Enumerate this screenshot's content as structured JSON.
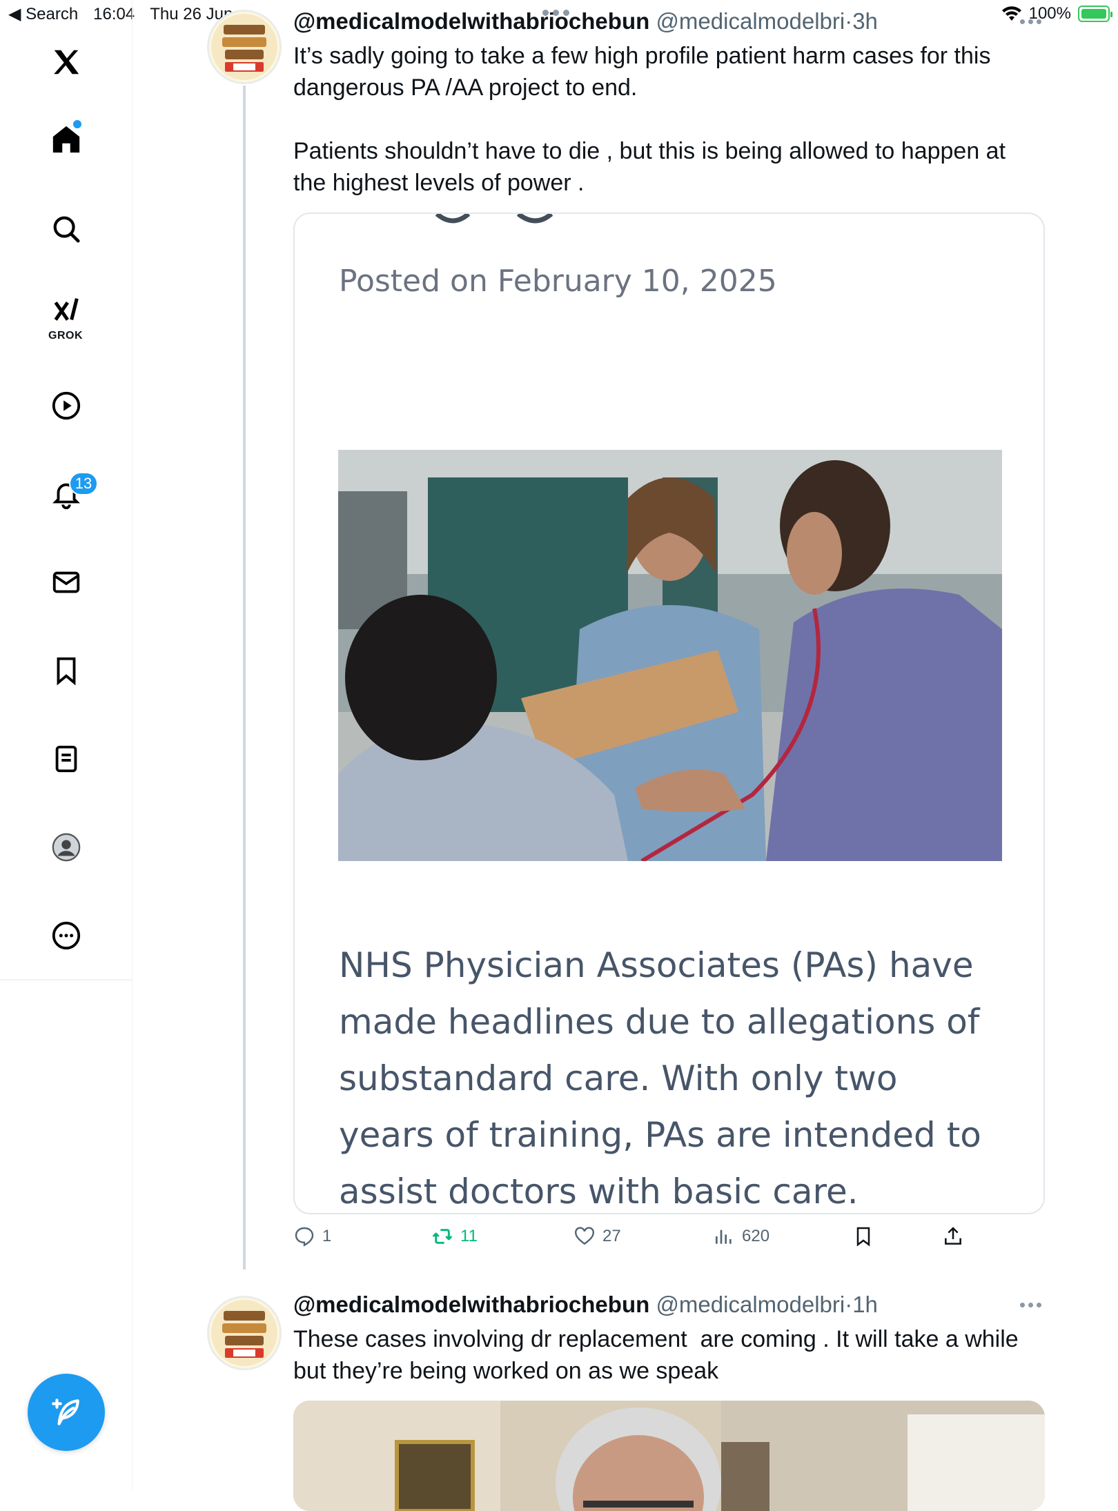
{
  "status_bar": {
    "back_label": "◀ Search",
    "time": "16:04",
    "date": "Thu 26 Jun",
    "battery": "100%"
  },
  "sidebar": {
    "grok_label": "GROK",
    "notifications_count": "13",
    "items": [
      "x-logo",
      "home-icon",
      "search-icon",
      "grok-icon",
      "video-icon",
      "notifications-icon",
      "messages-icon",
      "bookmarks-icon",
      "lists-icon",
      "profile-icon",
      "more-icon"
    ]
  },
  "tweets": [
    {
      "name": "@medicalmodelwithabriochebun",
      "handle": "@medicalmodelbri",
      "separator": "·",
      "time": "3h",
      "text": "It’s sadly going to take a few high profile patient harm cases for this dangerous PA /AA project to end.\n\nPatients shouldn’t have to die , but this is being allowed to happen at the highest levels of power .",
      "card": {
        "posted": "Posted on February 10, 2025",
        "article": "NHS Physician Associates (PAs) have made headlines due to allegations of substandard care. With only two years of training, PAs are intended to assist doctors with basic care. However, their"
      },
      "actions": {
        "replies": "1",
        "reposts": "11",
        "likes": "27",
        "views": "620"
      }
    },
    {
      "name": "@medicalmodelwithabriochebun",
      "handle": "@medicalmodelbri",
      "separator": "·",
      "time": "1h",
      "text": "These cases involving dr replacement  are coming . It will take a while but they’re being worked on as we speak"
    }
  ],
  "colors": {
    "accent": "#1d9bf0",
    "repost": "#00ba7c",
    "muted": "#536471"
  }
}
